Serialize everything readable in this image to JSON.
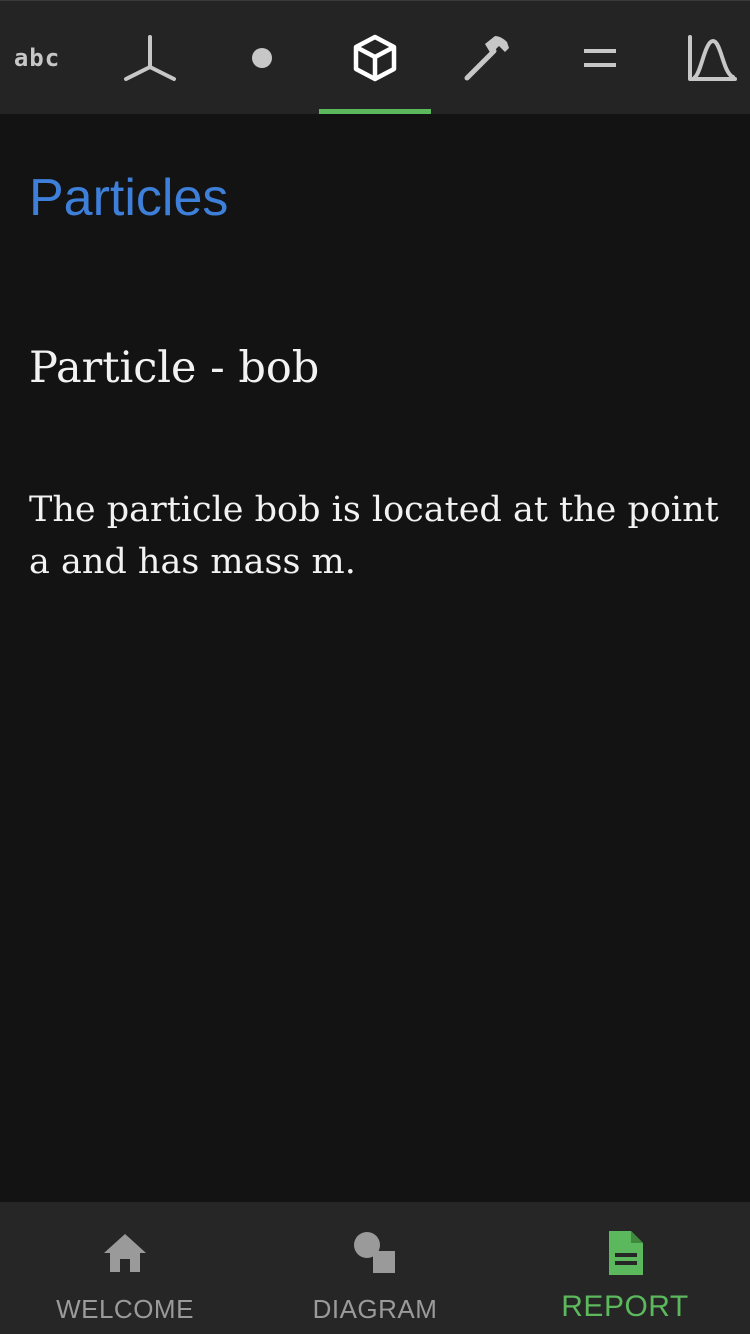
{
  "toolbar": {
    "tabs": [
      {
        "icon": "abc-text-icon",
        "text": "abc",
        "active": false
      },
      {
        "icon": "axes-icon",
        "active": false
      },
      {
        "icon": "point-icon",
        "active": false
      },
      {
        "icon": "cube-icon",
        "active": true
      },
      {
        "icon": "hammer-icon",
        "active": false
      },
      {
        "icon": "equals-icon",
        "active": false
      },
      {
        "icon": "curve-graph-icon",
        "active": false
      }
    ]
  },
  "report": {
    "section_title": "Particles",
    "item_title": "Particle - bob",
    "item_description": "The particle bob is located at the point a and has mass m."
  },
  "bottom_nav": {
    "items": [
      {
        "label": "WELCOME",
        "icon": "home-icon",
        "active": false
      },
      {
        "label": "DIAGRAM",
        "icon": "shapes-icon",
        "active": false
      },
      {
        "label": "REPORT",
        "icon": "document-icon",
        "active": true
      }
    ]
  },
  "colors": {
    "accent_green": "#5cb85c",
    "title_blue": "#3d7fd9",
    "toolbar_bg": "#242424",
    "content_bg": "#131313",
    "icon_gray": "#c7c7c7"
  }
}
